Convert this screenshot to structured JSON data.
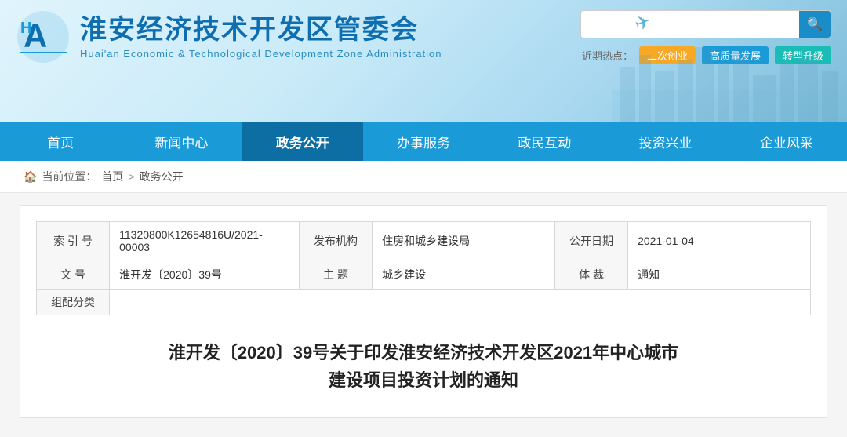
{
  "header": {
    "logo_title": "淮安经济技术开发区管委会",
    "logo_subtitle": "Huai'an Economic & Technological Development Zone Administration",
    "search_placeholder": "",
    "search_btn_icon": "🔍",
    "hot_label": "近期热点：",
    "tags": [
      {
        "label": "二次创业",
        "color": "yellow"
      },
      {
        "label": "高质量发展",
        "color": "blue"
      },
      {
        "label": "转型升级",
        "color": "teal"
      }
    ]
  },
  "nav": {
    "items": [
      {
        "label": "首页",
        "active": false
      },
      {
        "label": "新闻中心",
        "active": false
      },
      {
        "label": "政务公开",
        "active": true
      },
      {
        "label": "办事服务",
        "active": false
      },
      {
        "label": "政民互动",
        "active": false
      },
      {
        "label": "投资兴业",
        "active": false
      },
      {
        "label": "企业风采",
        "active": false
      }
    ]
  },
  "breadcrumb": {
    "icon": "🏠",
    "label": "当前位置：",
    "home": "首页",
    "separator": ">",
    "current": "政务公开"
  },
  "info_table": {
    "rows": [
      {
        "cells": [
          {
            "type": "label",
            "text": "索 引 号"
          },
          {
            "type": "value",
            "text": "11320800K12654816U/2021-00003"
          },
          {
            "type": "label",
            "text": "发布机构"
          },
          {
            "type": "value",
            "text": "住房和城乡建设局"
          },
          {
            "type": "label",
            "text": "公开日期"
          },
          {
            "type": "value",
            "text": "2021-01-04"
          }
        ]
      },
      {
        "cells": [
          {
            "type": "label",
            "text": "文 号"
          },
          {
            "type": "value",
            "text": "淮开发〔2020〕39号"
          },
          {
            "type": "label",
            "text": "主 题"
          },
          {
            "type": "value",
            "text": "城乡建设"
          },
          {
            "type": "label",
            "text": "体 裁"
          },
          {
            "type": "value",
            "text": "通知"
          }
        ]
      },
      {
        "cells": [
          {
            "type": "label",
            "text": "组配分类"
          },
          {
            "type": "value",
            "text": "",
            "colspan": 5
          }
        ]
      }
    ]
  },
  "doc_title": "淮开发〔2020〕39号关于印发淮安经济技术开发区2021年中心城市\n建设项目投资计划的通知"
}
